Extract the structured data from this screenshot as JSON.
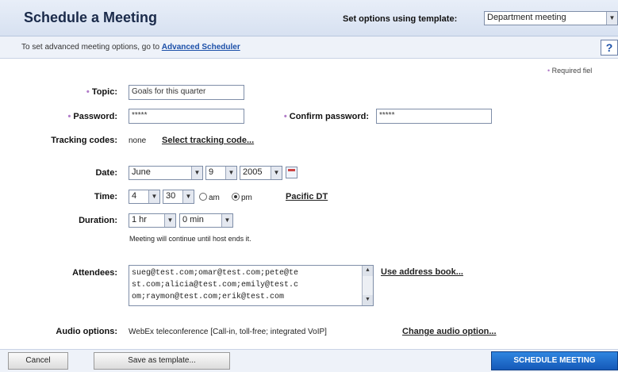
{
  "header": {
    "title": "Schedule a Meeting",
    "template_label": "Set options using template:",
    "template_value": "Department meeting"
  },
  "subbar": {
    "text": "To set advanced meeting options, go to",
    "link": "Advanced Scheduler"
  },
  "help_label": "?",
  "required_note": "Required fiel",
  "form": {
    "topic_label": "Topic:",
    "topic_value": "Goals for this quarter",
    "password_label": "Password:",
    "password_value": "*****",
    "confirm_label": "Confirm password:",
    "confirm_value": "*****",
    "tracking_label": "Tracking codes:",
    "tracking_value": "none",
    "tracking_link": "Select tracking code...",
    "date_label": "Date:",
    "date_month": "June",
    "date_day": "9",
    "date_year": "2005",
    "time_label": "Time:",
    "time_hour": "4",
    "time_minute": "30",
    "am_label": "am",
    "pm_label": "pm",
    "ampm_selected": "pm",
    "timezone_link": "Pacific DT",
    "duration_label": "Duration:",
    "duration_hr": "1 hr",
    "duration_min": "0 min",
    "duration_note": "Meeting will continue until host ends it.",
    "attendees_label": "Attendees:",
    "attendees_lines": [
      "sueg@test.com;omar@test.com;pete@te",
      "st.com;alicia@test.com;emily@test.c",
      "om;raymon@test.com;erik@test.com"
    ],
    "address_book_link": "Use address book...",
    "audio_label": "Audio options:",
    "audio_value": "WebEx teleconference [Call-in, toll-free; integrated VoIP]",
    "audio_link": "Change audio option..."
  },
  "footer": {
    "cancel": "Cancel",
    "save_template": "Save as template...",
    "schedule": "SCHEDULE MEETING"
  },
  "colors": {
    "accent": "#1b4fa8",
    "header_bg": "#dfe7f4",
    "primary_button": "#1e6fcc",
    "required_star": "#b07ac8"
  }
}
